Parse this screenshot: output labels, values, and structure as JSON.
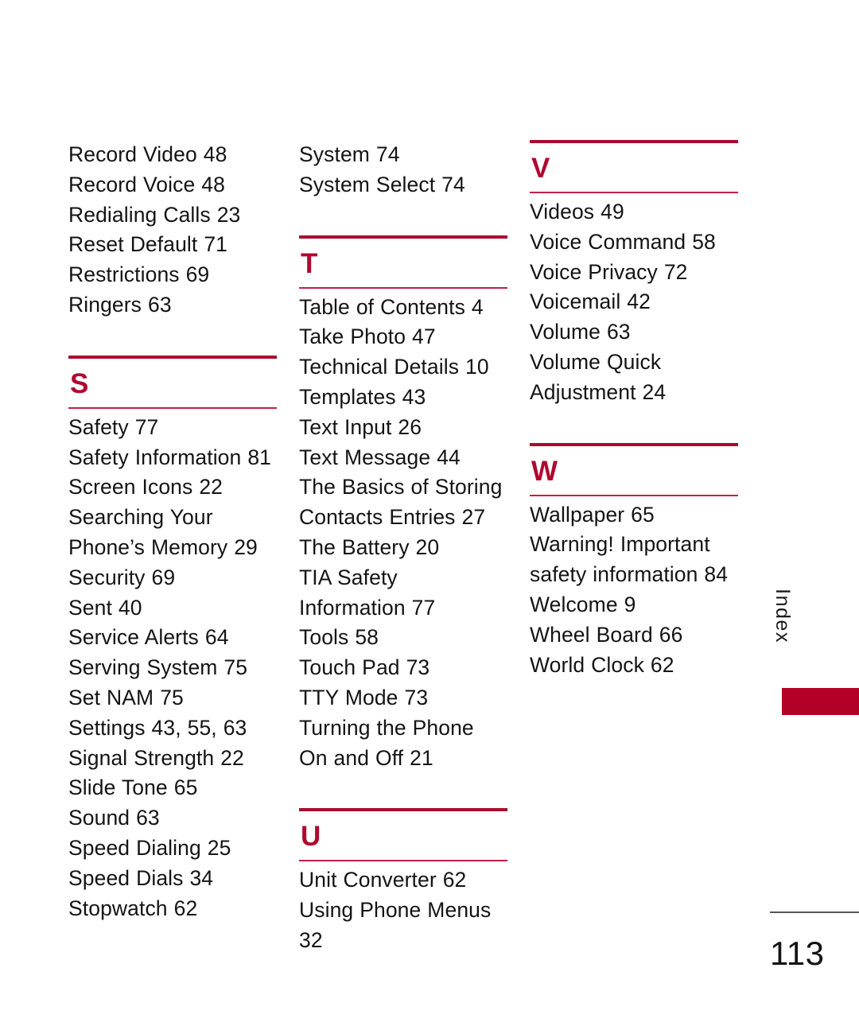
{
  "document": {
    "type": "index",
    "page_number": "113",
    "side_tab_label": "Index",
    "accent_color": "#B0082F",
    "rule_color_thick": "#A80B2E",
    "rule_color_thin": "#C32046",
    "tab_block_color": "#B30026",
    "footer_rule_color": "#555555"
  },
  "columns": [
    {
      "id": "column-1",
      "blocks": [
        {
          "type": "entries",
          "items": [
            "Record Video 48",
            "Record Voice 48",
            "Redialing Calls 23",
            "Reset Default 71",
            "Restrictions 69",
            "Ringers 63"
          ]
        },
        {
          "type": "section",
          "letter": "S",
          "items": [
            "Safety 77",
            "Safety Information 81",
            "Screen Icons 22",
            "Searching Your Phone’s Memory 29",
            "Security 69",
            "Sent 40",
            "Service Alerts 64",
            "Serving System 75",
            "Set NAM 75",
            "Settings 43, 55, 63",
            "Signal Strength 22",
            "Slide Tone 65",
            "Sound 63",
            "Speed Dialing 25",
            "Speed Dials 34",
            "Stopwatch 62"
          ]
        }
      ]
    },
    {
      "id": "column-2",
      "blocks": [
        {
          "type": "entries",
          "items": [
            "System 74",
            "System Select 74"
          ]
        },
        {
          "type": "section",
          "letter": "T",
          "items": [
            "Table of Contents 4",
            "Take Photo 47",
            "Technical Details 10",
            "Templates 43",
            "Text Input 26",
            "Text Message 44",
            "The Basics of Storing Contacts Entries 27",
            "The Battery 20",
            "TIA Safety Information 77",
            "Tools 58",
            "Touch Pad 73",
            "TTY Mode 73",
            "Turning the Phone On and Off 21"
          ]
        },
        {
          "type": "section",
          "letter": "U",
          "items": [
            "Unit Converter 62",
            "Using Phone Menus 32"
          ]
        }
      ]
    },
    {
      "id": "column-3",
      "blocks": [
        {
          "type": "section",
          "letter": "V",
          "items": [
            "Videos 49",
            "Voice Command 58",
            "Voice Privacy 72",
            "Voicemail 42",
            "Volume 63",
            "Volume Quick Adjustment 24"
          ]
        },
        {
          "type": "section",
          "letter": "W",
          "items": [
            "Wallpaper 65",
            "Warning! Important safety information 84",
            "Welcome 9",
            "Wheel Board 66",
            "World Clock 62"
          ]
        }
      ]
    }
  ]
}
